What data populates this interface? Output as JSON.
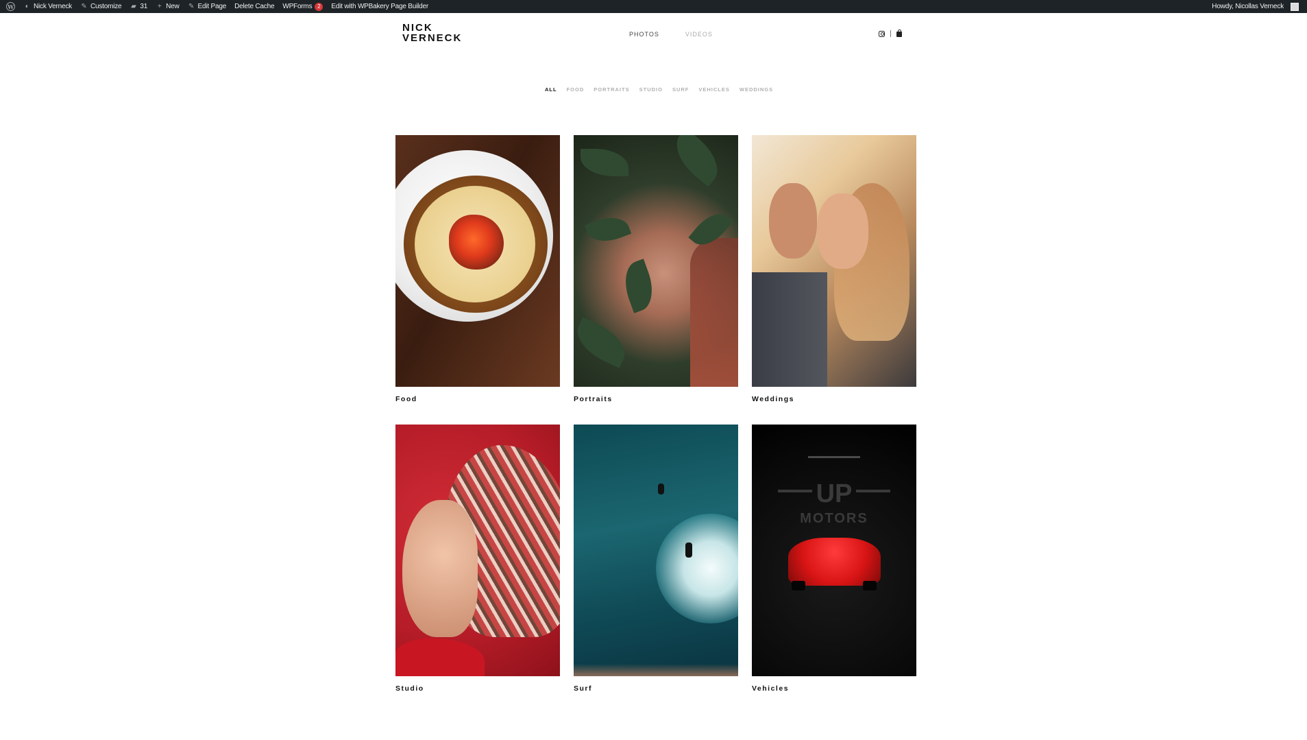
{
  "admin_bar": {
    "site_name": "Nick Verneck",
    "customize": "Customize",
    "comments_count": "31",
    "new": "New",
    "edit_page": "Edit Page",
    "delete_cache": "Delete Cache",
    "wpforms": "WPForms",
    "wpforms_badge": "2",
    "wpbakery": "Edit with WPBakery Page Builder",
    "howdy": "Howdy, Nicollas Verneck"
  },
  "site": {
    "logo_line1": "NICK",
    "logo_line2": "VERNECK",
    "nav": [
      {
        "label": "PHOTOS"
      },
      {
        "label": "VIDEOS"
      }
    ]
  },
  "filters": [
    "ALL",
    "FOOD",
    "PORTRAITS",
    "STUDIO",
    "SURF",
    "VEHICLES",
    "WEDDINGS"
  ],
  "gallery": [
    {
      "caption": "Food"
    },
    {
      "caption": "Portraits"
    },
    {
      "caption": "Weddings"
    },
    {
      "caption": "Studio"
    },
    {
      "caption": "Surf"
    },
    {
      "caption": "Vehicles"
    }
  ],
  "vehicle_sign": {
    "line1": "UP",
    "line2": "MOTORS"
  },
  "colors": {
    "admin_bar_bg": "#1d2327",
    "badge": "#d63638",
    "filter_active": "#111111",
    "filter_muted": "#b0b0b0"
  },
  "icons": [
    "wordpress-logo-icon",
    "customize-brush-icon",
    "comment-bubble-icon",
    "plus-icon",
    "pencil-icon",
    "instagram-icon",
    "shopping-bag-icon",
    "avatar-icon"
  ]
}
